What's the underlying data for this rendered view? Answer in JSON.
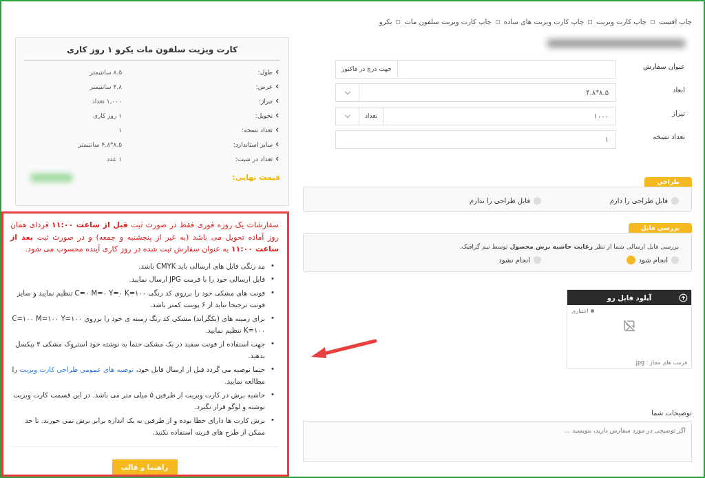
{
  "breadcrumb": [
    "چاپ افست",
    "چاپ کارت ویزیت",
    "چاپ کارت ویزیت های ساده",
    "چاپ کارت ویزیت سلفون مات",
    "یکرو"
  ],
  "summary": {
    "title": "کارت ویزیت سلفون مات یکرو ۱ روز کاری",
    "rows": [
      {
        "label": "طول:",
        "value": "۸.۵ سانتیمتر"
      },
      {
        "label": "عرض:",
        "value": "۴.۸ سانتیمتر"
      },
      {
        "label": "تیراژ:",
        "value": "۱,۰۰۰ تعداد"
      },
      {
        "label": "تحویل:",
        "value": "۱ روز کاری"
      },
      {
        "label": "تعداد نسخه:",
        "value": "۱"
      },
      {
        "label": "سایز استاندارد:",
        "value": "۸.۵*۴.۸ سانتیمتر"
      },
      {
        "label": "تعداد در شیت:",
        "value": "۱ عدد"
      }
    ],
    "price_label": "قیمت نهایی:"
  },
  "notice": {
    "intro": "سفارشات یک روزه فوری فقط در صورت ثبت **قبل از ساعت ۱۱:۰۰** فردای همان روز آماده تحویل می باشد (به غیر از پنجشنبه و جمعه) و در صورت ثبت **بعد از ساعت ۱۱:۰۰** به عنوان سفارش ثبت شده در روز کاری آینده محسوب می شود.",
    "marker": "•",
    "bullets": [
      {
        "text": "مد رنگی فایل های ارسالی باید CMYK باشد."
      },
      {
        "text": "فایل ارسالی خود را با فرمت JPG ارسال نمایید."
      },
      {
        "text": "فونت های مشکی خود را برروی کد رنگی C=۰ M=۰ Y=۰ K=۱۰۰ تنظیم نمایید و سایز فونت ترجیحا نباید از ۶ پوینت کمتر باشد."
      },
      {
        "text": "برای زمینه های (بکگراند) مشکی کد رنگ زمینه ی خود را برروی C=۱۰۰ M=۱۰۰ Y=۱۰۰ K=۱۰۰ تنظیم نمایید."
      },
      {
        "text": "جهت استفاده از فونت سفید در بک مشکی حتما به نوشته خود استروک مشکی ۲ پیکسل بدهید."
      },
      {
        "text": "حتما توصیه می گردد قبل از ارسال فایل خود،",
        "link": "توصیه های عمومی طراحی کارت ویزیت",
        "text_after": "را مطالعه نمایید."
      },
      {
        "text": "حاشیه برش در کارت ویزیت از طرفین ۵ میلی متر می باشد. در این قسمت کارت ویزیت نوشته و لوگو قرار نگیرد."
      },
      {
        "text": "برش کارت ها دارای خطا بوده و از طرفین به یک اندازه برابر برش نمی خورند. تا حد ممکن از طرح های قرینه استفاده نکنید."
      }
    ],
    "guide_button": "راهنما و قالب"
  },
  "form": {
    "fields": [
      {
        "label": "عنوان سفارش",
        "kind": "addon",
        "addon": "جهت درج در فاکتور"
      },
      {
        "label": "ابعاد",
        "kind": "select",
        "value": "۸.۵*۴.۸"
      },
      {
        "label": "تیراژ",
        "kind": "select_unit",
        "value": "۱۰۰۰",
        "unit": "تعداد"
      },
      {
        "label": "تعداد نسخه",
        "kind": "text",
        "value": "۱"
      }
    ]
  },
  "design": {
    "title": "طراحی",
    "options": [
      {
        "label": "فایل طراحی را دارم",
        "selected": false
      },
      {
        "label": "فایل طراحی را ندارم",
        "selected": false
      }
    ]
  },
  "file_check": {
    "title": "بررسی فایل",
    "description": "بررسی فایل ارسالی شما از نظر **رعایت حاشیه برش محصول** توسط تیم گرافیک.",
    "options": [
      {
        "label": "انجام شود",
        "selected": false,
        "info": true
      },
      {
        "label": "انجام نشود",
        "selected": false
      }
    ]
  },
  "upload": {
    "title": "آپلود فایل رو",
    "optional": "اختیاری",
    "formats": "فرمت های مجاز : jpg."
  },
  "comments": {
    "label": "توضیحات شما",
    "placeholder": "اگر توضیحی در مورد سفارش دارید، بنویسید ..."
  }
}
